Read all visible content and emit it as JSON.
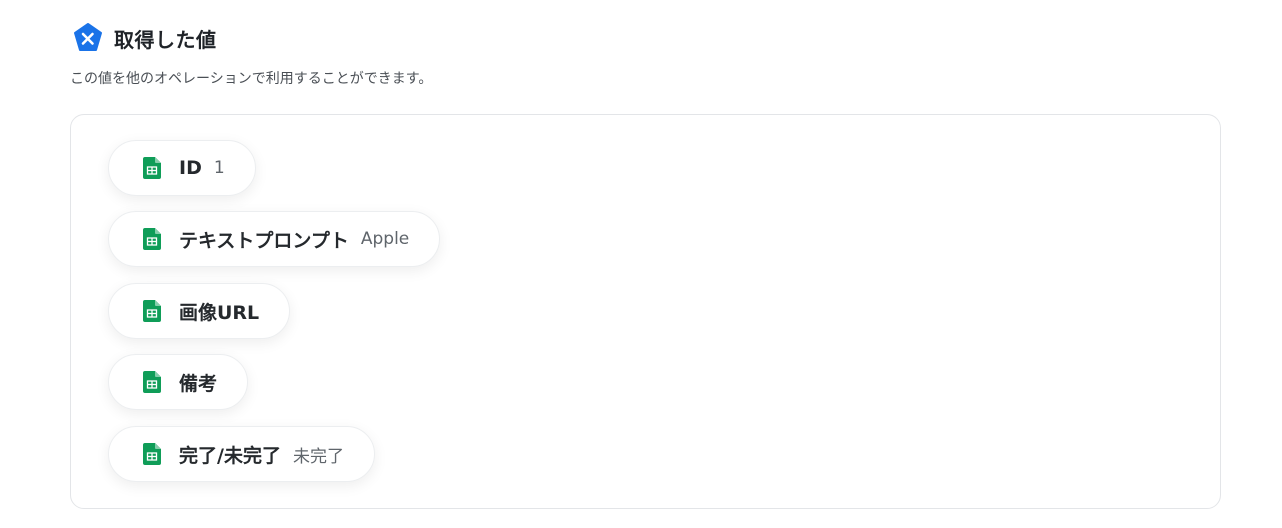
{
  "header": {
    "title": "取得した値",
    "subtitle": "この値を他のオペレーションで利用することができます。",
    "icon": "yoom-x-badge-icon",
    "accent_color": "#1a73e8"
  },
  "fields": [
    {
      "label": "ID",
      "value": "1",
      "icon": "google-sheets-icon"
    },
    {
      "label": "テキストプロンプト",
      "value": "Apple",
      "icon": "google-sheets-icon"
    },
    {
      "label": "画像URL",
      "value": "",
      "icon": "google-sheets-icon"
    },
    {
      "label": "備考",
      "value": "",
      "icon": "google-sheets-icon"
    },
    {
      "label": "完了/未完了",
      "value": "未完了",
      "icon": "google-sheets-icon"
    }
  ],
  "colors": {
    "sheets_green": "#0f9d58",
    "panel_border": "#e3e5e8"
  }
}
